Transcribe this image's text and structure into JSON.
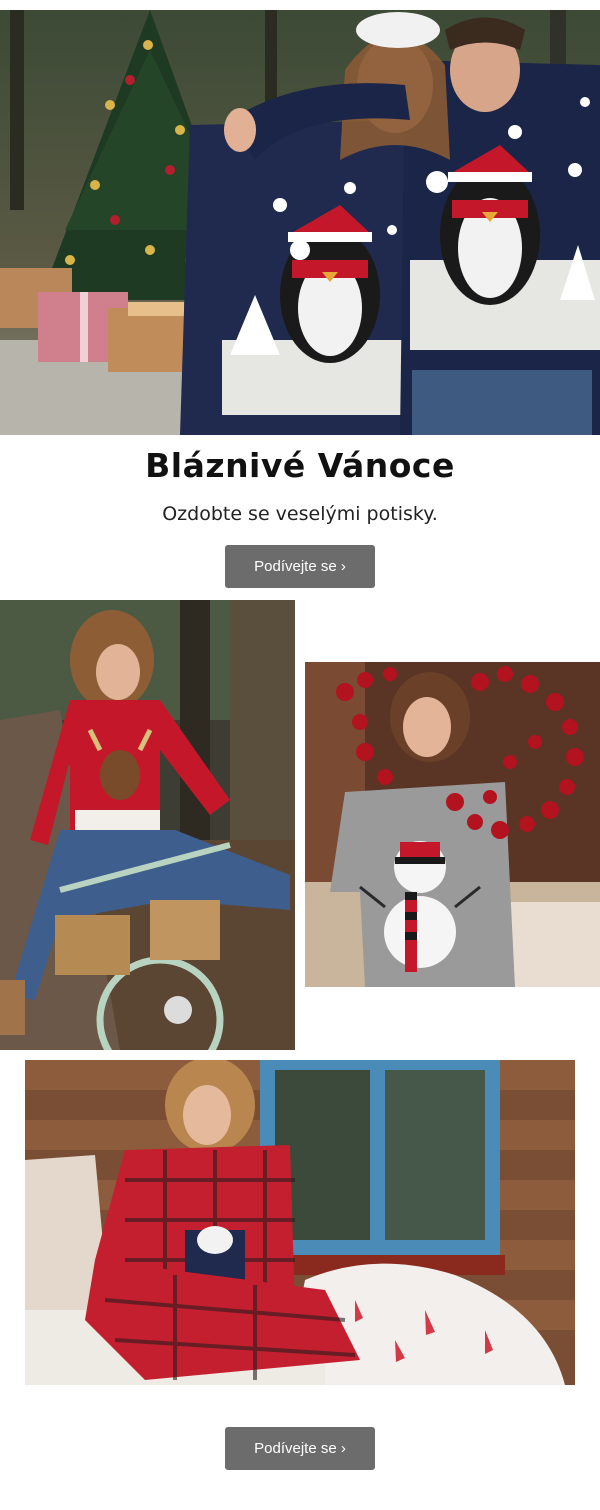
{
  "hero": {
    "title": "Bláznivé Vánoce",
    "subtitle": "Ozdobte se veselými potisky."
  },
  "cta_top": {
    "label": "Podívejte se ›"
  },
  "cta_bottom": {
    "label": "Podívejte se ›"
  },
  "colors": {
    "button_bg": "#6c6c6c",
    "button_text": "#ffffff",
    "title_text": "#111111",
    "sweater_navy": "#1f2a4e",
    "sweater_red": "#c4182a",
    "sweater_grey": "#9a9a9a"
  }
}
